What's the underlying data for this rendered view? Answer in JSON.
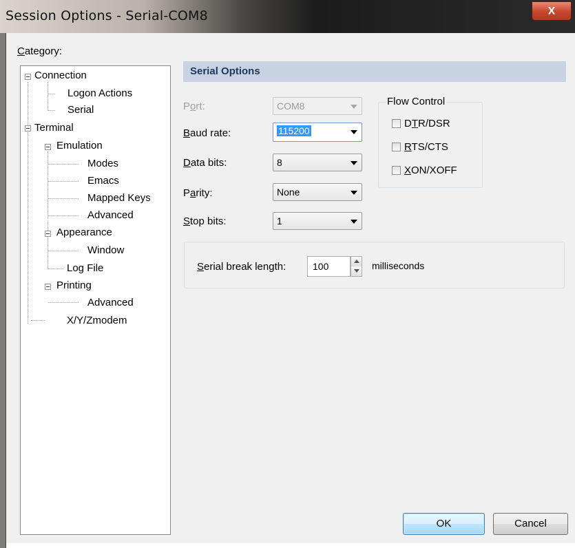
{
  "window": {
    "title": "Session Options - Serial-COM8",
    "close_glyph": "X"
  },
  "category": {
    "label_underlined": "C",
    "label_rest": "ategory:",
    "tree": [
      {
        "label": "Connection"
      },
      {
        "label": "Logon Actions"
      },
      {
        "label": "Serial"
      },
      {
        "label": "Terminal"
      },
      {
        "label": "Emulation"
      },
      {
        "label": "Modes"
      },
      {
        "label": "Emacs"
      },
      {
        "label": "Mapped Keys"
      },
      {
        "label": "Advanced"
      },
      {
        "label": "Appearance"
      },
      {
        "label": "Window"
      },
      {
        "label": "Log File"
      },
      {
        "label": "Printing"
      },
      {
        "label": "Advanced"
      },
      {
        "label": "X/Y/Zmodem"
      }
    ]
  },
  "serial_options": {
    "header": "Serial Options",
    "port": {
      "label_a": "P",
      "label_u": "o",
      "label_b": "rt:",
      "value": "COM8"
    },
    "baud_rate": {
      "label_u": "B",
      "label_b": "aud rate:",
      "value": "115200"
    },
    "data_bits": {
      "label_u": "D",
      "label_b": "ata bits:",
      "value": "8"
    },
    "parity": {
      "label_a": "P",
      "label_u": "a",
      "label_b": "rity:",
      "value": "None"
    },
    "stop_bits": {
      "label_u": "S",
      "label_b": "top bits:",
      "value": "1"
    },
    "flow_control": {
      "title": "Flow Control",
      "options": [
        {
          "label_a": "D",
          "label_u": "T",
          "label_b": "R/DSR",
          "checked": false
        },
        {
          "label_a": "",
          "label_u": "R",
          "label_b": "TS/CTS",
          "checked": false
        },
        {
          "label_a": "",
          "label_u": "X",
          "label_b": "ON/XOFF",
          "checked": false
        }
      ]
    },
    "serial_break": {
      "label_u": "S",
      "label_b": "erial break length:",
      "value": "100",
      "unit": "milliseconds"
    }
  },
  "buttons": {
    "ok": "OK",
    "cancel": "Cancel"
  }
}
